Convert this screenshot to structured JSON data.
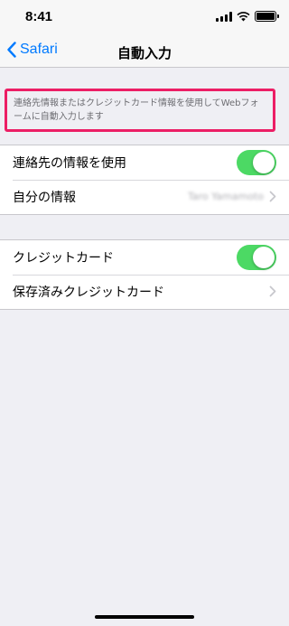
{
  "status_bar": {
    "time": "8:41"
  },
  "nav": {
    "back_label": "Safari",
    "title": "自動入力"
  },
  "description": "連絡先情報またはクレジットカード情報を使用してWebフォームに自動入力します",
  "contact_group": {
    "use_contact_label": "連絡先の情報を使用",
    "use_contact_on": true,
    "my_info_label": "自分の情報",
    "my_info_value": "Taro Yamamoto"
  },
  "card_group": {
    "credit_card_label": "クレジットカード",
    "credit_card_on": true,
    "saved_cards_label": "保存済みクレジットカード"
  },
  "colors": {
    "accent": "#007aff",
    "toggle_on": "#4cd964",
    "highlight": "#ec1e65"
  }
}
